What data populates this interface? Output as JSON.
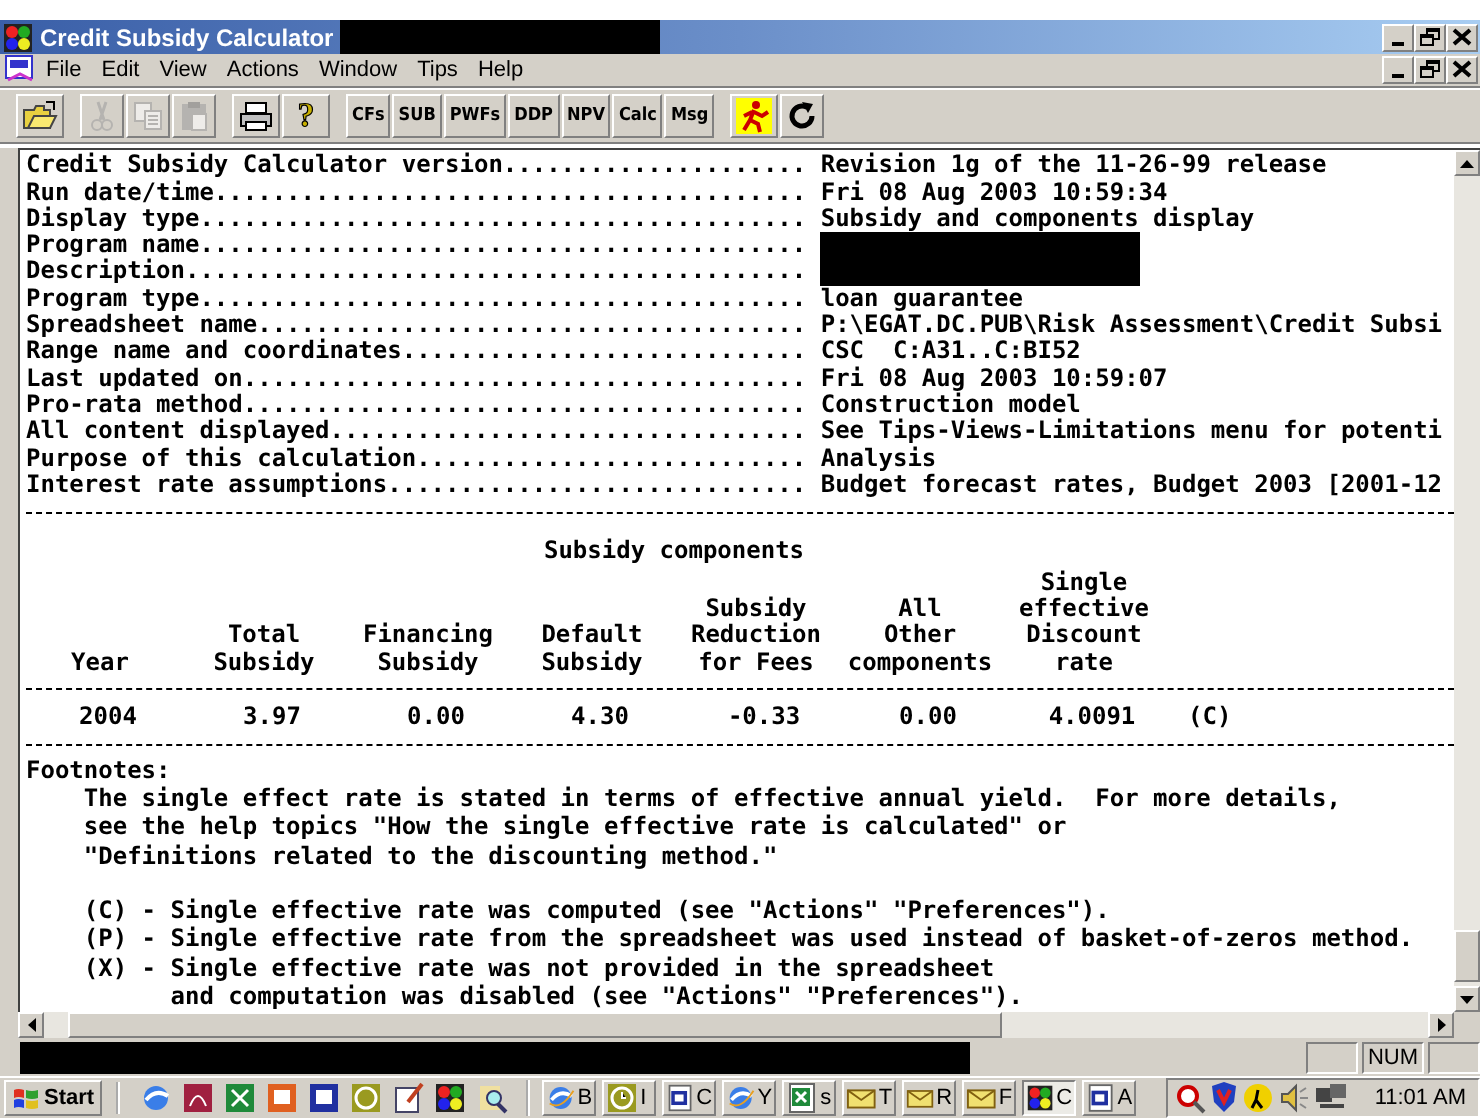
{
  "window": {
    "title": "Credit Subsidy Calculator"
  },
  "menu": [
    "File",
    "Edit",
    "View",
    "Actions",
    "Window",
    "Tips",
    "Help"
  ],
  "toolbar": {
    "groups": [
      {
        "items": [
          {
            "kind": "open",
            "disabled": false
          }
        ]
      },
      {
        "items": [
          {
            "kind": "cut",
            "disabled": true
          },
          {
            "kind": "copy",
            "disabled": true
          },
          {
            "kind": "paste",
            "disabled": true
          }
        ]
      },
      {
        "items": [
          {
            "kind": "print",
            "disabled": false
          },
          {
            "kind": "help",
            "label": "?",
            "disabled": false
          }
        ]
      },
      {
        "items": [
          {
            "kind": "text",
            "label": "CFs",
            "disabled": false
          },
          {
            "kind": "text",
            "label": "SUB",
            "disabled": false
          },
          {
            "kind": "text",
            "label": "PWFs",
            "disabled": false
          },
          {
            "kind": "text",
            "label": "DDP",
            "disabled": false
          },
          {
            "kind": "text",
            "label": "NPV",
            "disabled": false
          },
          {
            "kind": "text",
            "label": "Calc",
            "disabled": false
          },
          {
            "kind": "text",
            "label": "Msg",
            "disabled": false
          }
        ]
      },
      {
        "items": [
          {
            "kind": "run",
            "disabled": false
          },
          {
            "kind": "refresh",
            "disabled": false
          }
        ]
      }
    ]
  },
  "report": {
    "info": [
      {
        "label": "Credit Subsidy Calculator version.....................",
        "value": "Revision 1g of the 11-26-99 release",
        "redacted": false
      },
      {
        "label": "Run date/time.........................................",
        "value": "Fri 08 Aug 2003 10:59:34",
        "redacted": false
      },
      {
        "label": "Display type..........................................",
        "value": "Subsidy and components display",
        "redacted": false
      },
      {
        "label": "Program name..........................................",
        "redacted": true
      },
      {
        "label": "Description...........................................",
        "redacted": true
      },
      {
        "label": "Program type..........................................",
        "value": "loan guarantee",
        "redacted": false
      },
      {
        "label": "Spreadsheet name......................................",
        "value": "P:\\EGAT.DC.PUB\\Risk Assessment\\Credit Subsi",
        "redacted": false
      },
      {
        "label": "Range name and coordinates............................",
        "value": "CSC  C:A31..C:BI52",
        "redacted": false
      },
      {
        "label": "Last updated on.......................................",
        "value": "Fri 08 Aug 2003 10:59:07",
        "redacted": false
      },
      {
        "label": "Pro-rata method.......................................",
        "value": "Construction model",
        "redacted": false
      },
      {
        "label": "All content displayed.................................",
        "value": "See Tips-Views-Limitations menu for potenti",
        "redacted": false
      },
      {
        "label": "Purpose of this calculation...........................",
        "value": "Analysis",
        "redacted": false
      },
      {
        "label": "Interest rate assumptions.............................",
        "value": "Budget forecast rates, Budget 2003 [2001-12",
        "redacted": false
      }
    ],
    "table": {
      "group_title": "Subsidy components",
      "columns": [
        {
          "lines": [
            "Year"
          ],
          "grouped": false
        },
        {
          "lines": [
            "Total",
            "Subsidy"
          ],
          "grouped": false
        },
        {
          "lines": [
            "Financing",
            "Subsidy"
          ],
          "grouped": true
        },
        {
          "lines": [
            "Default",
            "Subsidy"
          ],
          "grouped": true
        },
        {
          "lines": [
            "Subsidy",
            "Reduction",
            "for Fees"
          ],
          "grouped": true
        },
        {
          "lines": [
            "All",
            "Other",
            "components"
          ],
          "grouped": true
        },
        {
          "lines": [
            "Single",
            "effective",
            "Discount",
            "rate"
          ],
          "grouped": false
        }
      ],
      "rows": [
        {
          "cells": [
            "2004",
            "3.97",
            "0.00",
            "4.30",
            "-0.33",
            "0.00",
            "4.0091"
          ],
          "note": "(C)"
        }
      ]
    },
    "footnotes": {
      "title": "Footnotes:",
      "text": "The single effect rate is stated in terms of effective annual yield.  For more details,\nsee the help topics \"How the single effective rate is calculated\" or\n\"Definitions related to the discounting method.\"",
      "notes": [
        "(C) - Single effective rate was computed (see \"Actions\" \"Preferences\").",
        "(P) - Single effective rate from the spreadsheet was used instead of basket-of-zeros method.",
        "(X) - Single effective rate was not provided in the spreadsheet\n      and computation was disabled (see \"Actions\" \"Preferences\")."
      ]
    }
  },
  "status_bar": {
    "num_indicator": "NUM"
  },
  "taskbar": {
    "start": "Start",
    "tasks": [
      {
        "label": "B",
        "kind": "browser",
        "selected": false
      },
      {
        "label": "I",
        "kind": "clock",
        "selected": false
      },
      {
        "label": "C",
        "kind": "document",
        "selected": false
      },
      {
        "label": "Y",
        "kind": "browser",
        "selected": false
      },
      {
        "label": "s",
        "kind": "sheet",
        "selected": false
      },
      {
        "label": "T",
        "kind": "mail",
        "selected": false
      },
      {
        "label": "R",
        "kind": "mail",
        "selected": false
      },
      {
        "label": "F",
        "kind": "mail",
        "selected": false
      },
      {
        "label": "C",
        "kind": "app",
        "selected": true
      },
      {
        "label": "A",
        "kind": "document",
        "selected": false
      }
    ],
    "clock": "11:01 AM"
  }
}
